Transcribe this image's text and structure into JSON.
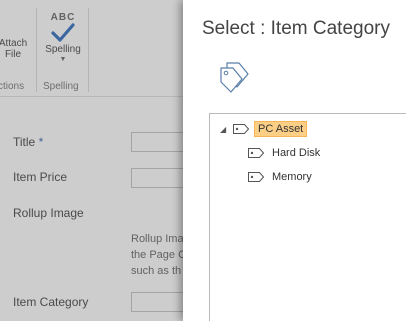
{
  "ribbon": {
    "attach_file_label": "Attach File",
    "attach_line1": "Attach",
    "attach_line2": "File",
    "spelling_icon_text": "ABC",
    "spelling_label": "Spelling",
    "group_actions_label": "ctions",
    "group_spelling_label": "Spelling"
  },
  "form": {
    "title_label": "Title",
    "title_required": "*",
    "item_price_label": "Item Price",
    "rollup_image_label": "Rollup Image",
    "rollup_help_line1": "Rollup Ima",
    "rollup_help_line2": "the Page C",
    "rollup_help_line3": "such as th",
    "item_category_label": "Item Category"
  },
  "dialog": {
    "title": "Select : Item Category",
    "header_icon": "tags-icon",
    "tree": {
      "root": {
        "label": "PC Asset",
        "expanded": true,
        "selected": true,
        "children": [
          {
            "label": "Hard Disk"
          },
          {
            "label": "Memory"
          }
        ]
      }
    }
  },
  "colors": {
    "selection_fill": "#fccf87",
    "selection_border": "#f5b653",
    "spell_check": "#2f6dbf",
    "required_marker": "#3c6db5"
  }
}
